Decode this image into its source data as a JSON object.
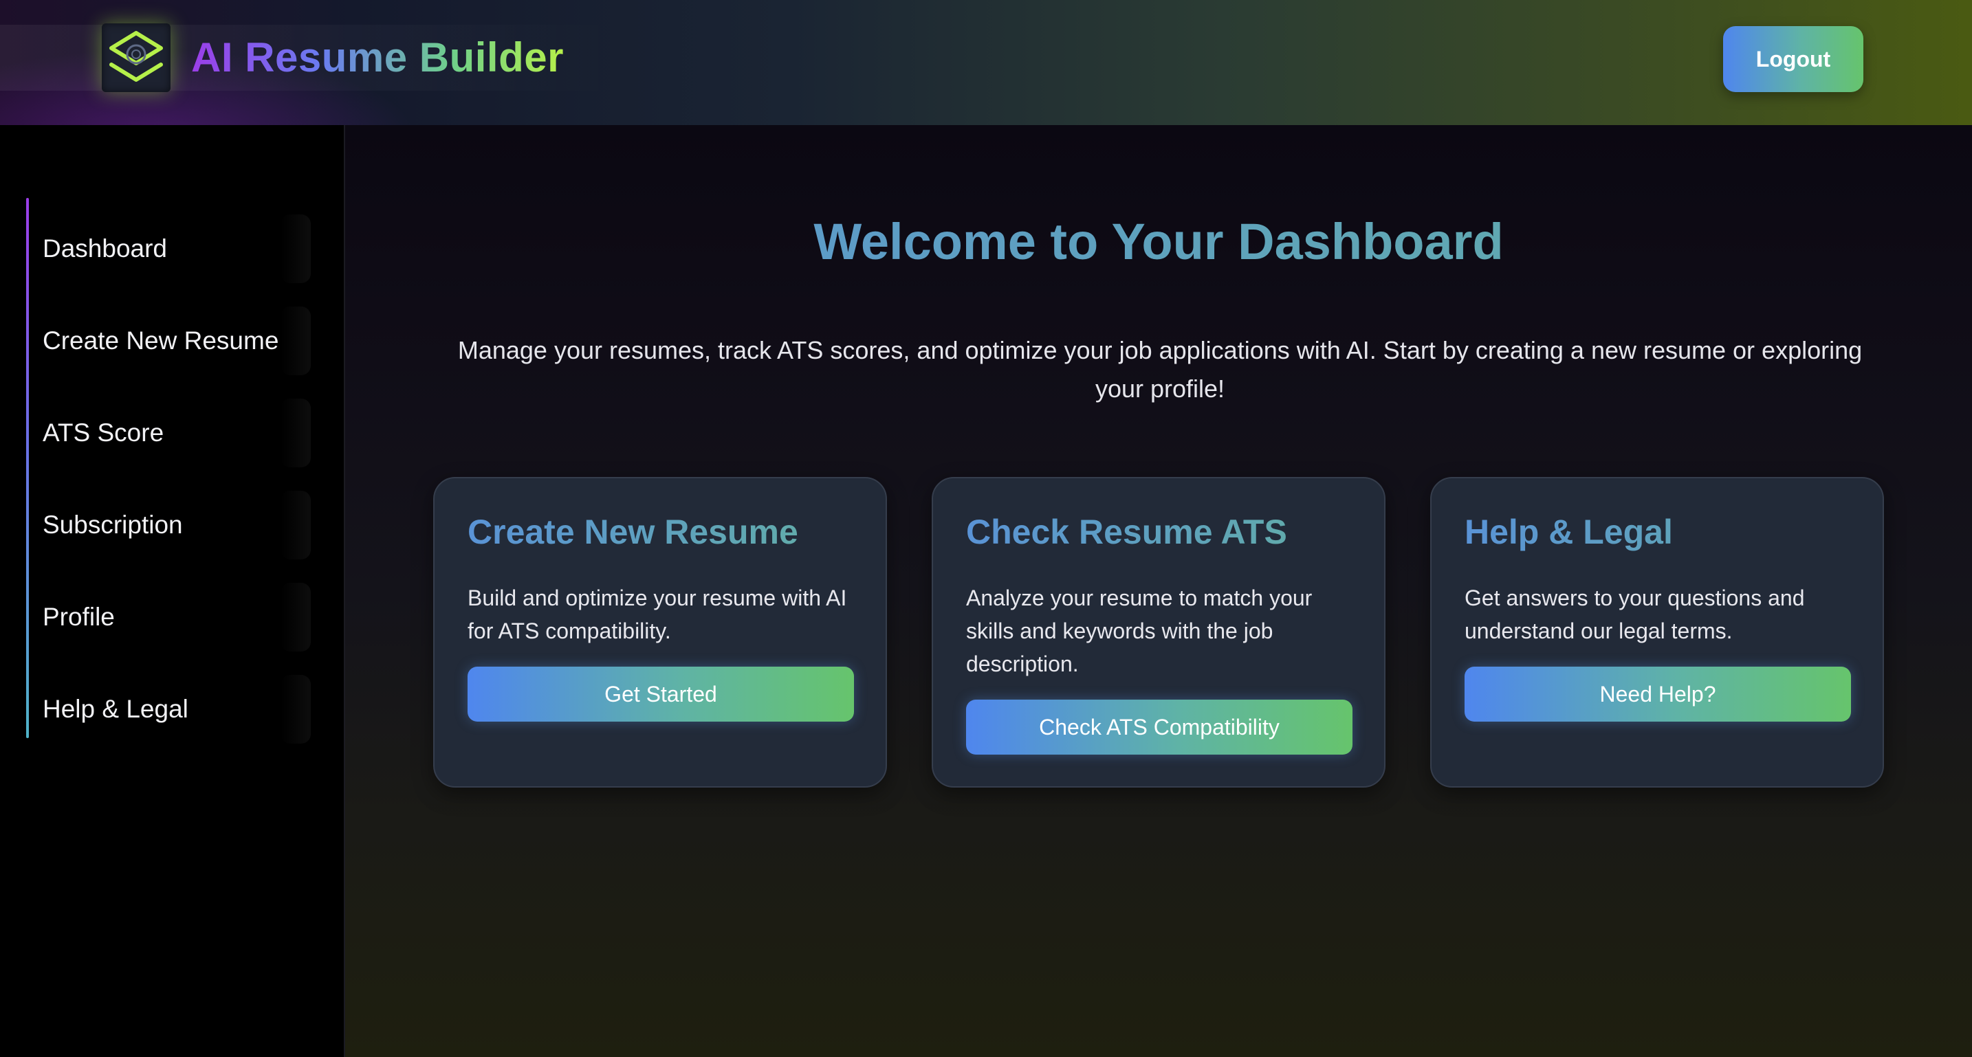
{
  "header": {
    "brand_title": "AI Resume Builder",
    "logo_icon": "layers-logo-icon",
    "logout_label": "Logout"
  },
  "sidebar": {
    "items": [
      {
        "label": "Dashboard"
      },
      {
        "label": "Create New Resume"
      },
      {
        "label": "ATS Score"
      },
      {
        "label": "Subscription"
      },
      {
        "label": "Profile"
      },
      {
        "label": "Help & Legal"
      }
    ]
  },
  "main": {
    "title": "Welcome to Your Dashboard",
    "intro": "Manage your resumes, track ATS scores, and optimize your job applications with AI. Start by creating a new resume or exploring your profile!",
    "cards": [
      {
        "title": "Create New Resume",
        "description": "Build and optimize your resume with AI for ATS compatibility.",
        "button": "Get Started"
      },
      {
        "title": "Check Resume ATS",
        "description": "Analyze your resume to match your skills and keywords with the job description.",
        "button": "Check ATS Compatibility"
      },
      {
        "title": "Help & Legal",
        "description": "Get answers to your questions and understand our legal terms.",
        "button": "Need Help?"
      }
    ]
  },
  "colors": {
    "accent_blue": "#4f86ee",
    "accent_green": "#66c46c",
    "accent_purple": "#9b3ee8",
    "accent_lime": "#b6f04a",
    "card_bg": "#222a38"
  }
}
